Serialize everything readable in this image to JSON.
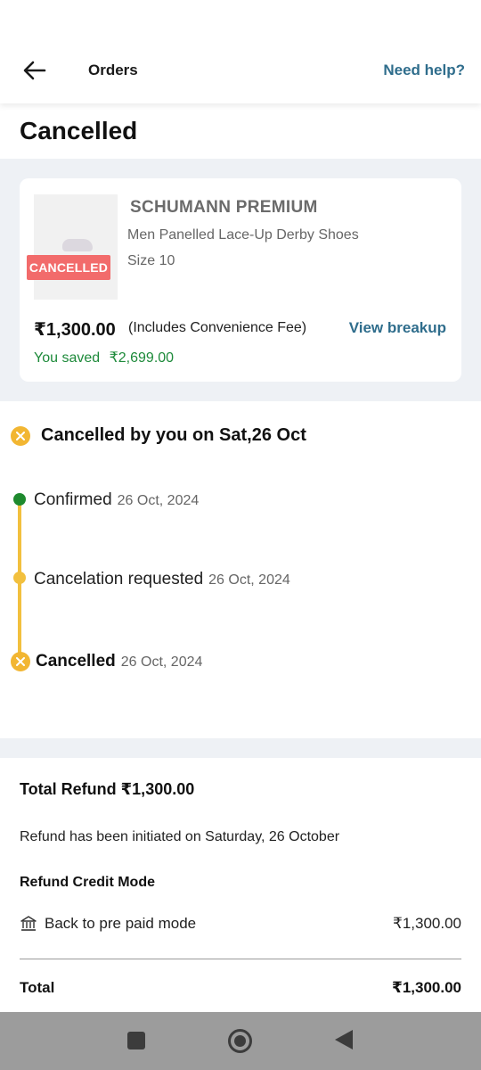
{
  "header": {
    "title": "Orders",
    "help_label": "Need help?"
  },
  "page_title": "Cancelled",
  "product": {
    "badge": "CANCELLED",
    "brand": "SCHUMANN PREMIUM",
    "name": "Men Panelled Lace-Up Derby Shoes",
    "size": "Size 10",
    "price": "₹1,300.00",
    "price_note": "(Includes Convenience Fee)",
    "breakup_label": "View breakup",
    "saved_label": "You saved",
    "saved_amount": "₹2,699.00"
  },
  "status": {
    "title": "Cancelled by you on Sat,26 Oct",
    "timeline": [
      {
        "label": "Confirmed",
        "date": "26 Oct, 2024"
      },
      {
        "label": "Cancelation requested",
        "date": "26 Oct, 2024"
      },
      {
        "label": "Cancelled",
        "date": "26 Oct, 2024"
      }
    ]
  },
  "refund": {
    "title": "Total Refund ₹1,300.00",
    "note": "Refund has been initiated on Saturday, 26 October",
    "mode_heading": "Refund Credit Mode",
    "mode_label": "Back to pre paid mode",
    "mode_amount": "₹1,300.00",
    "total_label": "Total",
    "total_amount": "₹1,300.00"
  },
  "colors": {
    "accent_link": "#2f6d8c",
    "cancel_badge": "#f26b6b",
    "saved_green": "#1d8a3a",
    "timeline_yellow": "#f2c03e",
    "confirmed_green": "#1e8a2e"
  },
  "icons": [
    "back-arrow-icon",
    "cancel-x-icon",
    "bank-icon",
    "nav-recents-icon",
    "nav-home-icon",
    "nav-back-icon"
  ]
}
